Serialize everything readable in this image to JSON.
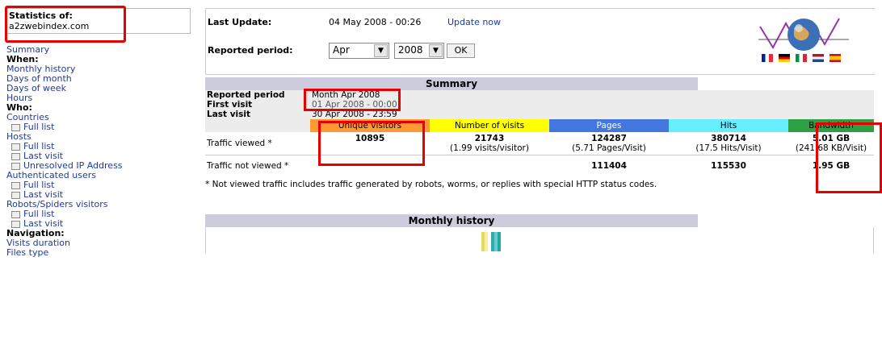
{
  "site": {
    "stats_label": "Statistics of:",
    "domain": "a2zwebindex.com"
  },
  "menu": [
    {
      "text": "Summary",
      "kind": "link"
    },
    {
      "text": "When:",
      "kind": "head"
    },
    {
      "text": "Monthly history",
      "kind": "link"
    },
    {
      "text": "Days of month",
      "kind": "link"
    },
    {
      "text": "Days of week",
      "kind": "link"
    },
    {
      "text": "Hours",
      "kind": "link"
    },
    {
      "text": "Who:",
      "kind": "head"
    },
    {
      "text": "Countries",
      "kind": "link"
    },
    {
      "text": "Full list",
      "kind": "sub"
    },
    {
      "text": "Hosts",
      "kind": "link"
    },
    {
      "text": "Full list",
      "kind": "sub"
    },
    {
      "text": "Last visit",
      "kind": "sub"
    },
    {
      "text": "Unresolved IP Address",
      "kind": "sub"
    },
    {
      "text": "Authenticated users",
      "kind": "link"
    },
    {
      "text": "Full list",
      "kind": "sub"
    },
    {
      "text": "Last visit",
      "kind": "sub"
    },
    {
      "text": "Robots/Spiders visitors",
      "kind": "link"
    },
    {
      "text": "Full list",
      "kind": "sub"
    },
    {
      "text": "Last visit",
      "kind": "sub"
    },
    {
      "text": "Navigation:",
      "kind": "head"
    },
    {
      "text": "Visits duration",
      "kind": "link"
    },
    {
      "text": "Files type",
      "kind": "link"
    }
  ],
  "top": {
    "last_update_label": "Last Update:",
    "last_update_value": "04 May 2008 - 00:26",
    "update_now": "Update now",
    "period_label": "Reported period:",
    "month": "Apr",
    "year": "2008",
    "ok": "OK"
  },
  "summary": {
    "title": "Summary",
    "reported_period_label": "Reported period",
    "reported_period_value": "Month Apr 2008",
    "first_visit_label": "First visit",
    "first_visit_value": "01 Apr 2008 - 00:00",
    "last_visit_label": "Last visit",
    "last_visit_value": "30 Apr 2008 - 23:59",
    "col_unique": "Unique visitors",
    "col_visits": "Number of visits",
    "col_pages": "Pages",
    "col_hits": "Hits",
    "col_bandwidth": "Bandwidth",
    "viewed_label": "Traffic viewed *",
    "viewed_unique": "10895",
    "viewed_visits": "21743",
    "viewed_visits_sub": "(1.99 visits/visitor)",
    "viewed_pages": "124287",
    "viewed_pages_sub": "(5.71 Pages/Visit)",
    "viewed_hits": "380714",
    "viewed_hits_sub": "(17.5 Hits/Visit)",
    "viewed_bw": "5.01 GB",
    "viewed_bw_sub": "(241.68 KB/Visit)",
    "notviewed_label": "Traffic not viewed *",
    "notviewed_pages": "111404",
    "notviewed_hits": "115530",
    "notviewed_bw": "1.95 GB",
    "note": "* Not viewed traffic includes traffic generated by robots, worms, or replies with special HTTP status codes."
  },
  "monthly": {
    "title": "Monthly history"
  },
  "colors": {
    "unique": "#ff9933",
    "visits": "#ffff00",
    "pages": "#4477dd",
    "hits": "#66eeff",
    "bandwidth": "#2ea043",
    "highlight": "#e60000"
  }
}
